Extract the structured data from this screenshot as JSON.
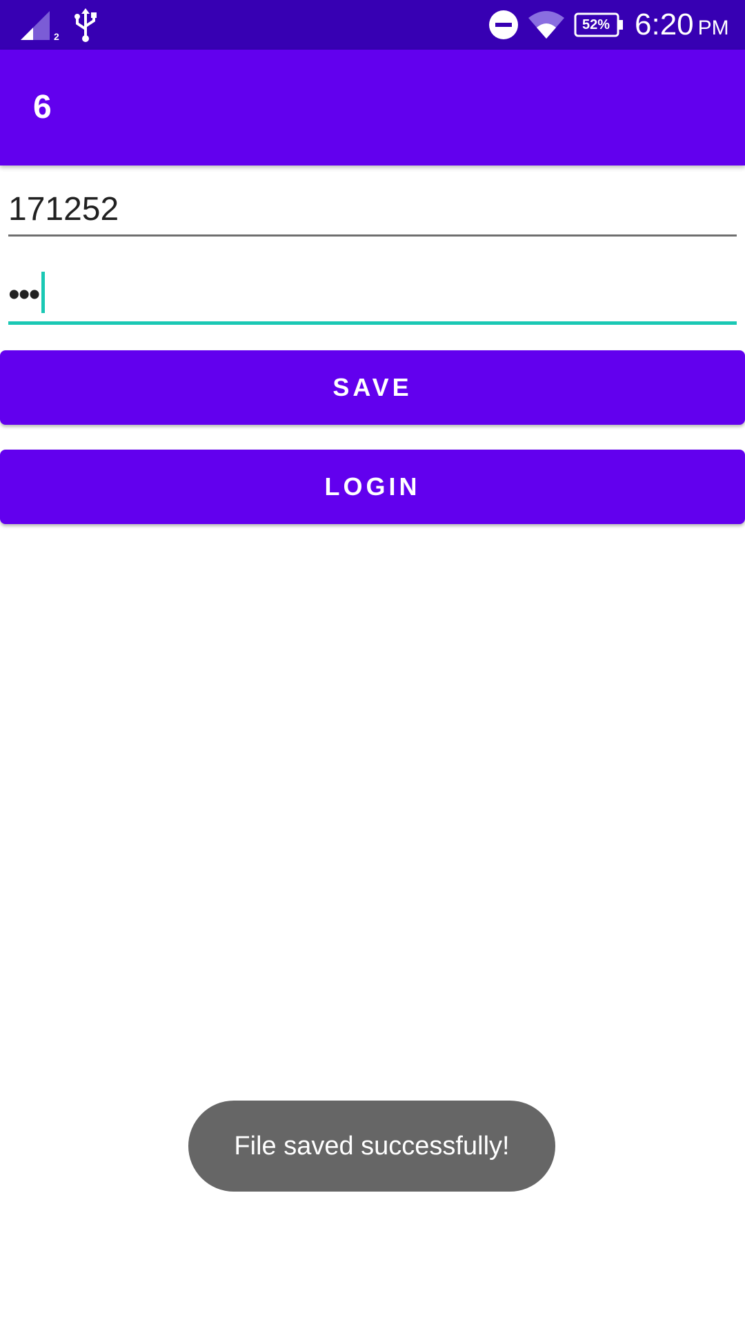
{
  "status_bar": {
    "time": "6:20",
    "ampm": "PM",
    "battery": "52%",
    "sim_slot": "2",
    "icons": [
      "signal-icon",
      "usb-icon",
      "dnd-icon",
      "wifi-icon",
      "battery-icon"
    ],
    "background": "#3700b3"
  },
  "app_bar": {
    "title": "6",
    "background": "#6200ee"
  },
  "form": {
    "username_value": "171252",
    "password_value": "•••",
    "accent": "#1ac8b4"
  },
  "buttons": {
    "save_label": "SAVE",
    "login_label": "LOGIN",
    "color": "#6200ee"
  },
  "toast": {
    "message": "File saved successfully!"
  }
}
